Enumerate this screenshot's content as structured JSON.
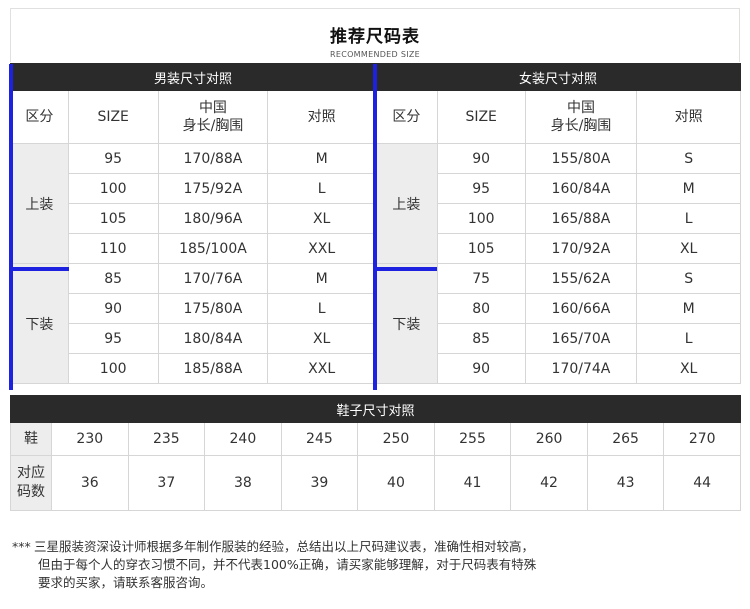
{
  "title": "推荐尺码表",
  "subtitle": "RECOMMENDED SIZE",
  "men": {
    "header": "男装尺寸对照",
    "cols": [
      "区分",
      "SIZE",
      "中国",
      "身长/胸围",
      "对照"
    ],
    "groups": [
      {
        "label": "上装",
        "rows": [
          [
            "95",
            "170/88A",
            "M"
          ],
          [
            "100",
            "175/92A",
            "L"
          ],
          [
            "105",
            "180/96A",
            "XL"
          ],
          [
            "110",
            "185/100A",
            "XXL"
          ]
        ]
      },
      {
        "label": "下装",
        "rows": [
          [
            "85",
            "170/76A",
            "M"
          ],
          [
            "90",
            "175/80A",
            "L"
          ],
          [
            "95",
            "180/84A",
            "XL"
          ],
          [
            "100",
            "185/88A",
            "XXL"
          ]
        ]
      }
    ]
  },
  "women": {
    "header": "女装尺寸对照",
    "cols": [
      "区分",
      "SIZE",
      "中国",
      "身长/胸围",
      "对照"
    ],
    "groups": [
      {
        "label": "上装",
        "rows": [
          [
            "90",
            "155/80A",
            "S"
          ],
          [
            "95",
            "160/84A",
            "M"
          ],
          [
            "100",
            "165/88A",
            "L"
          ],
          [
            "105",
            "170/92A",
            "XL"
          ]
        ]
      },
      {
        "label": "下装",
        "rows": [
          [
            "75",
            "155/62A",
            "S"
          ],
          [
            "80",
            "160/66A",
            "M"
          ],
          [
            "85",
            "165/70A",
            "L"
          ],
          [
            "90",
            "170/74A",
            "XL"
          ]
        ]
      }
    ]
  },
  "shoes": {
    "header": "鞋子尺寸对照",
    "row1_label": "鞋",
    "row1": [
      "230",
      "235",
      "240",
      "245",
      "250",
      "255",
      "260",
      "265",
      "270"
    ],
    "row2_label_a": "对应",
    "row2_label_b": "码数",
    "row2": [
      "36",
      "37",
      "38",
      "39",
      "40",
      "41",
      "42",
      "43",
      "44"
    ]
  },
  "note": {
    "stars": "***",
    "line1": "三星服装资深设计师根据多年制作服装的经验，总结出以上尺码建议表，准确性相对较高，",
    "line2": "但由于每个人的穿衣习惯不同，并不代表100%正确，请买家能够理解，对于尺码表有特殊",
    "line3": "要求的买家，请联系客服咨询。"
  },
  "colors": {
    "header_bg": "#2a2a2a",
    "group_bg": "#ededed",
    "highlight": "#1c22e0"
  }
}
